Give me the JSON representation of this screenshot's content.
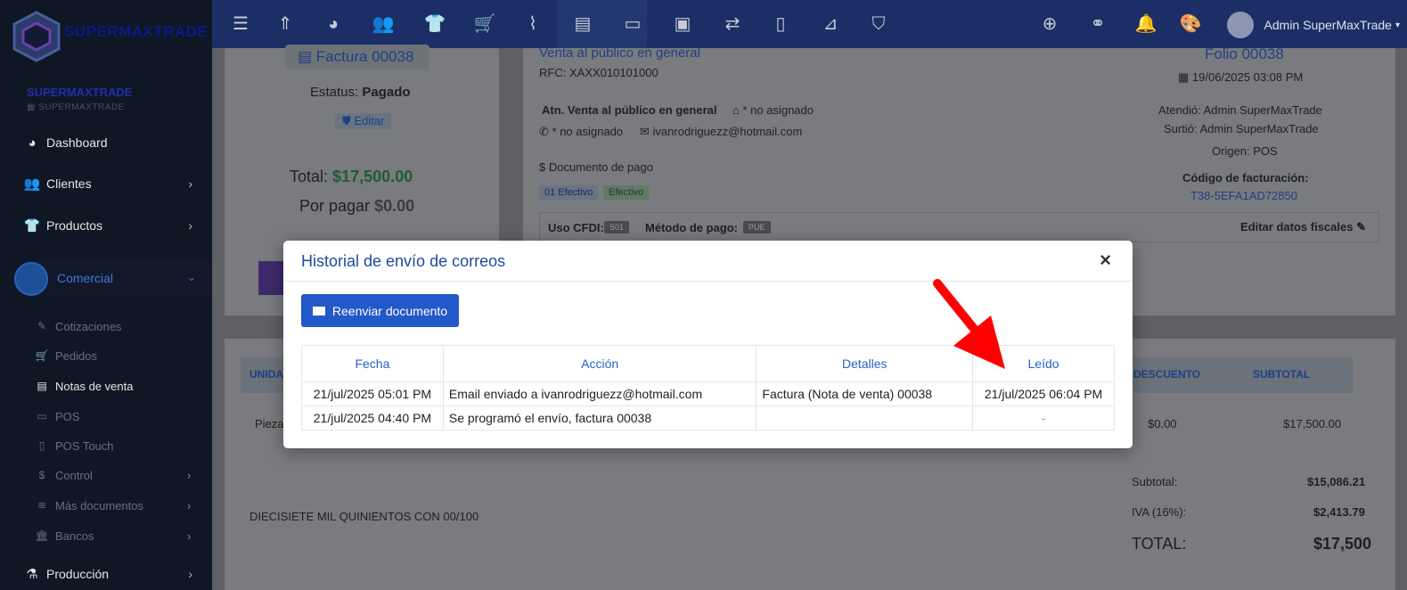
{
  "brand": {
    "logo_text": "SUPERMAXTRADE",
    "company_name": "SUPERMAXTRADE",
    "company_sub": "SUPERMAXTRADE"
  },
  "sidebar": {
    "items": [
      {
        "label": "Dashboard",
        "icon": "palette-icon"
      },
      {
        "label": "Clientes",
        "icon": "users-icon"
      },
      {
        "label": "Productos",
        "icon": "shirt-icon"
      }
    ],
    "active": {
      "label": "Comercial",
      "icon": "briefcase-icon"
    },
    "subitems": [
      {
        "label": "Cotizaciones",
        "icon": "edit-icon"
      },
      {
        "label": "Pedidos",
        "icon": "cart-icon"
      },
      {
        "label": "Notas de venta",
        "icon": "list-icon"
      },
      {
        "label": "POS",
        "icon": "monitor-icon"
      },
      {
        "label": "POS Touch",
        "icon": "tablet-icon"
      },
      {
        "label": "Control",
        "icon": "dollar-icon"
      },
      {
        "label": "Más documentos",
        "icon": "layers-icon"
      },
      {
        "label": "Bancos",
        "icon": "bank-icon"
      }
    ],
    "bottom": {
      "label": "Producción",
      "icon": "flask-icon"
    }
  },
  "topbar": {
    "user_name": "Admin SuperMaxTrade"
  },
  "invoice": {
    "title": "Factura 00038",
    "status_label": "Estatus:",
    "status_value": "Pagado",
    "edit_label": "Editar",
    "total_label": "Total:",
    "total_value": "$17,500.00",
    "due_label": "Por pagar",
    "due_value": "$0.00",
    "customer": "Venta al público en general",
    "rfc": "RFC: XAXX010101000",
    "attn": "Atn. Venta al público en general",
    "not_assigned_1": "* no asignado",
    "not_assigned_2": "* no asignado",
    "email": "ivanrodriguezz@hotmail.com",
    "payment_doc": "$ Documento de pago",
    "payment_code": "01 Efectivo",
    "payment_type": "Efectivo",
    "cfdi_label": "Uso CFDI:",
    "cfdi_value": "S01",
    "method_label": "Método de pago:",
    "method_value": "PUE",
    "edit_fiscal": "Editar datos fiscales",
    "folio": "Folio 00038",
    "date": "19/06/2025 03:08 PM",
    "attended": "Atendió: Admin SuperMaxTrade",
    "supplied": "Surtió: Admin SuperMaxTrade",
    "origin": "Origen: POS",
    "billing_code_label": "Código de facturación:",
    "billing_code": "T38-5EFA1AD72850",
    "col_unit": "UNIDA",
    "col_discount": "DESCUENTO",
    "col_subtotal": "SUBTOTAL",
    "row_unit": "Pieza",
    "row_discount": "$0.00",
    "row_subtotal": "$17,500.00",
    "amount_words": "DIECISIETE MIL QUINIENTOS CON 00/100",
    "subtotal_label": "Subtotal:",
    "subtotal_value": "$15,086.21",
    "iva_label": "IVA (16%):",
    "iva_value": "$2,413.79",
    "grand_label": "TOTAL:",
    "grand_value": "$17,500"
  },
  "modal": {
    "title": "Historial de envío de correos",
    "close": "×",
    "resend_label": "Reenviar documento",
    "headers": [
      "Fecha",
      "Acción",
      "Detalles",
      "Leído"
    ],
    "rows": [
      {
        "fecha": "21/jul/2025 05:01 PM",
        "accion": "Email enviado a ivanrodriguezz@hotmail.com",
        "detalles": "Factura (Nota de venta) 00038",
        "leido": "21/jul/2025 06:04 PM"
      },
      {
        "fecha": "21/jul/2025 04:40 PM",
        "accion": "Se programó el envío, factura 00038",
        "detalles": "",
        "leido": "-"
      }
    ]
  },
  "colors": {
    "arrow": "#ff0000",
    "accent": "#2358c9",
    "topbar": "#1b2f66",
    "sidebar": "#0f1624"
  }
}
